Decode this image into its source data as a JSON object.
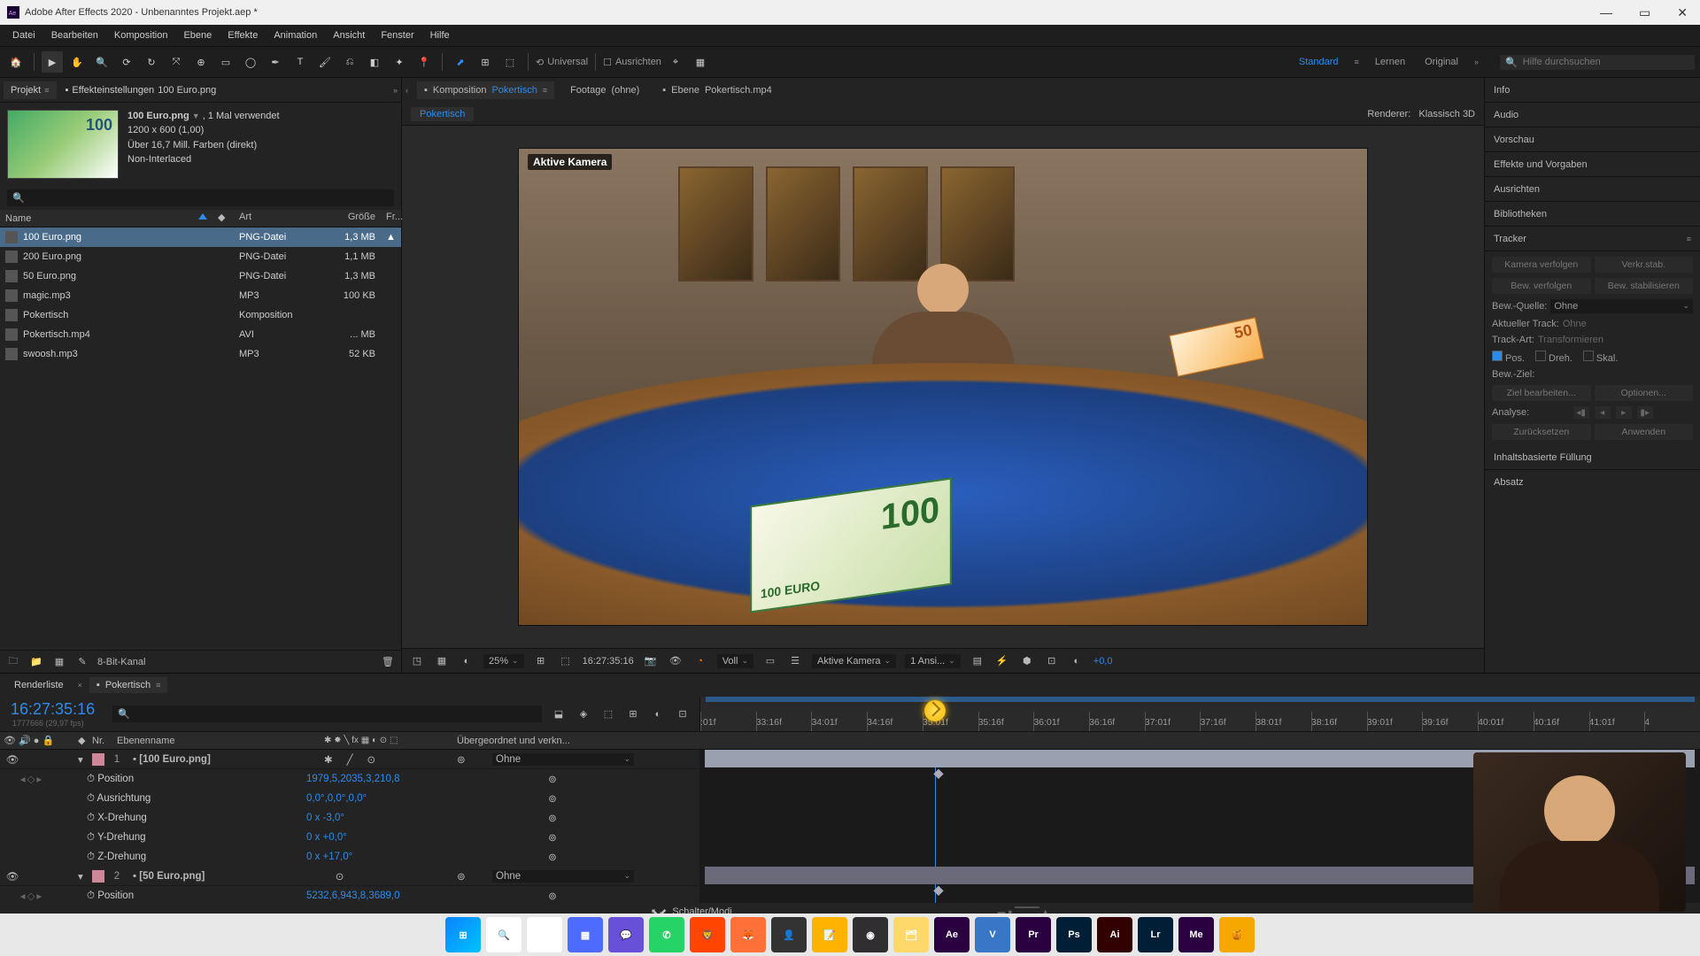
{
  "window_title": "Adobe After Effects 2020 - Unbenanntes Projekt.aep *",
  "menu": [
    "Datei",
    "Bearbeiten",
    "Komposition",
    "Ebene",
    "Effekte",
    "Animation",
    "Ansicht",
    "Fenster",
    "Hilfe"
  ],
  "toolbar": {
    "snapping_label": "Universal",
    "align_label": "Ausrichten",
    "search_placeholder": "Hilfe durchsuchen"
  },
  "workspaces": {
    "items": [
      "Standard",
      "Lernen",
      "Original"
    ],
    "active": "Standard"
  },
  "project_panel": {
    "tabs": {
      "project": "Projekt",
      "effect_controls_prefix": "Effekteinstellungen",
      "effect_controls_asset": "100 Euro.png"
    },
    "selected_asset": {
      "name": "100 Euro.png",
      "usage": ", 1 Mal verwendet",
      "dims": "1200 x 600 (1,00)",
      "colors": "Über 16,7 Mill. Farben (direkt)",
      "interlace": "Non-Interlaced"
    },
    "columns": {
      "name": "Name",
      "art": "Art",
      "size": "Größe",
      "fr": "Fr..."
    },
    "rows": [
      {
        "name": "100 Euro.png",
        "art": "PNG-Datei",
        "size": "1,3 MB",
        "selected": true,
        "used": true
      },
      {
        "name": "200 Euro.png",
        "art": "PNG-Datei",
        "size": "1,1 MB"
      },
      {
        "name": "50 Euro.png",
        "art": "PNG-Datei",
        "size": "1,3 MB"
      },
      {
        "name": "magic.mp3",
        "art": "MP3",
        "size": "100 KB"
      },
      {
        "name": "Pokertisch",
        "art": "Komposition",
        "size": ""
      },
      {
        "name": "Pokertisch.mp4",
        "art": "AVI",
        "size": "... MB"
      },
      {
        "name": "swoosh.mp3",
        "art": "MP3",
        "size": "52 KB"
      }
    ],
    "footer_bpc": "8-Bit-Kanal"
  },
  "comp_tabs": {
    "comp_prefix": "Komposition",
    "comp_name": "Pokertisch",
    "footage_prefix": "Footage",
    "footage_name": "(ohne)",
    "layer_prefix": "Ebene",
    "layer_name": "Pokertisch.mp4"
  },
  "breadcrumb": {
    "item": "Pokertisch",
    "renderer_label": "Renderer:",
    "renderer_value": "Klassisch 3D"
  },
  "viewer": {
    "active_camera_label": "Aktive Kamera",
    "footer": {
      "zoom": "25%",
      "timecode": "16:27:35:16",
      "resolution": "Voll",
      "camera": "Aktive Kamera",
      "views": "1 Ansi...",
      "exposure": "+0,0"
    }
  },
  "right_panels": {
    "items": [
      "Info",
      "Audio",
      "Vorschau",
      "Effekte und Vorgaben",
      "Ausrichten",
      "Bibliotheken"
    ],
    "tracker": {
      "title": "Tracker",
      "btn_track_camera": "Kamera verfolgen",
      "btn_warp_stab": "Verkr.stab.",
      "btn_track_motion": "Bew. verfolgen",
      "btn_stabilize": "Bew. stabilisieren",
      "source_label": "Bew.-Quelle:",
      "source_value": "Ohne",
      "cur_track_label": "Aktueller Track:",
      "cur_track_value": "Ohne",
      "track_type_label": "Track-Art:",
      "track_type_value": "Transformieren",
      "pos": "Pos.",
      "rot": "Dreh.",
      "scale": "Skal.",
      "target_label": "Bew.-Ziel:",
      "btn_edit_target": "Ziel bearbeiten...",
      "btn_options": "Optionen...",
      "analyze_label": "Analyse:",
      "btn_reset": "Zurücksetzen",
      "btn_apply": "Anwenden"
    },
    "content_fill": "Inhaltsbasierte Füllung",
    "absatz": "Absatz"
  },
  "timeline": {
    "tabs": {
      "render": "Renderliste",
      "comp": "Pokertisch"
    },
    "timecode": "16:27:35:16",
    "timecode_sub": "1777666 (29,97 fps)",
    "cols": {
      "nr": "Nr.",
      "name": "Ebenenname",
      "parent": "Übergeordnet und verkn..."
    },
    "ruler": [
      ":01f",
      "33:16f",
      "34:01f",
      "34:16f",
      "35:01f",
      "35:16f",
      "36:01f",
      "36:16f",
      "37:01f",
      "37:16f",
      "38:01f",
      "38:16f",
      "39:01f",
      "39:16f",
      "40:01f",
      "40:16f",
      "41:01f",
      "4"
    ],
    "playhead_pct": 23.5,
    "layers": [
      {
        "nr": "1",
        "name": "[100 Euro.png]",
        "parent": "Ohne",
        "selected": true,
        "props": [
          {
            "name": "Position",
            "value": "1979,5,2035,3,210,8",
            "kf": true
          },
          {
            "name": "Ausrichtung",
            "value": "0,0°,0,0°,0,0°"
          },
          {
            "name": "X-Drehung",
            "value": "0 x -3,0°"
          },
          {
            "name": "Y-Drehung",
            "value": "0 x +0,0°"
          },
          {
            "name": "Z-Drehung",
            "value": "0 x +17,0°"
          }
        ]
      },
      {
        "nr": "2",
        "name": "[50 Euro.png]",
        "parent": "Ohne",
        "props": [
          {
            "name": "Position",
            "value": "5232,6,943,8,3689,0",
            "kf": true
          }
        ]
      }
    ],
    "footer": "Schalter/Modi"
  },
  "taskbar_apps": [
    "windows",
    "search",
    "taskview",
    "widgets",
    "video-chat",
    "whatsapp",
    "brave",
    "firefox",
    "something",
    "notes",
    "obs",
    "file-explorer",
    "ae",
    "vegas",
    "pr",
    "ps",
    "ai",
    "lr",
    "me",
    "honey"
  ]
}
